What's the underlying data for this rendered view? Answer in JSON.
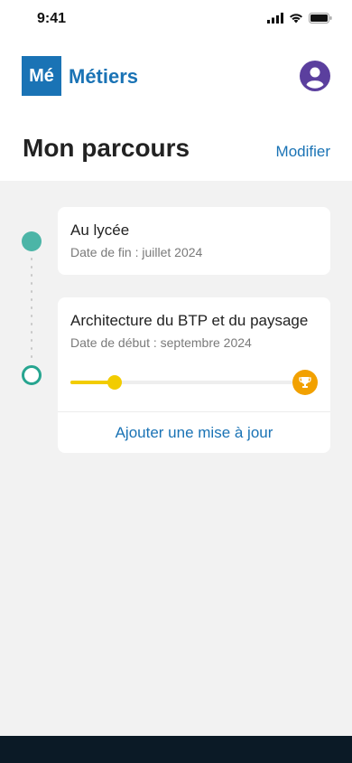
{
  "status_bar": {
    "time": "9:41",
    "icons": [
      "signal-icon",
      "wifi-icon",
      "battery-icon"
    ]
  },
  "header": {
    "logo_text": "Mé",
    "app_name": "Métiers",
    "avatar_icon": "user-avatar-icon"
  },
  "page": {
    "title": "Mon parcours",
    "edit_label": "Modifier"
  },
  "timeline": [
    {
      "title": "Au lycée",
      "subtitle": "Date de fin : juillet 2024",
      "status": "completed"
    },
    {
      "title": "Architecture du BTP et du paysage",
      "subtitle": "Date de début : septembre 2024",
      "status": "in-progress",
      "progress": 0.2,
      "goal_icon": "trophy-icon",
      "action_label": "Ajouter une mise à jour"
    }
  ],
  "colors": {
    "brand": "#1a73b5",
    "timeline_done": "#4cb5a7",
    "timeline_current": "#27a590",
    "progress": "#f2cc00",
    "trophy": "#f2a100",
    "avatar": "#5b3f9e"
  }
}
